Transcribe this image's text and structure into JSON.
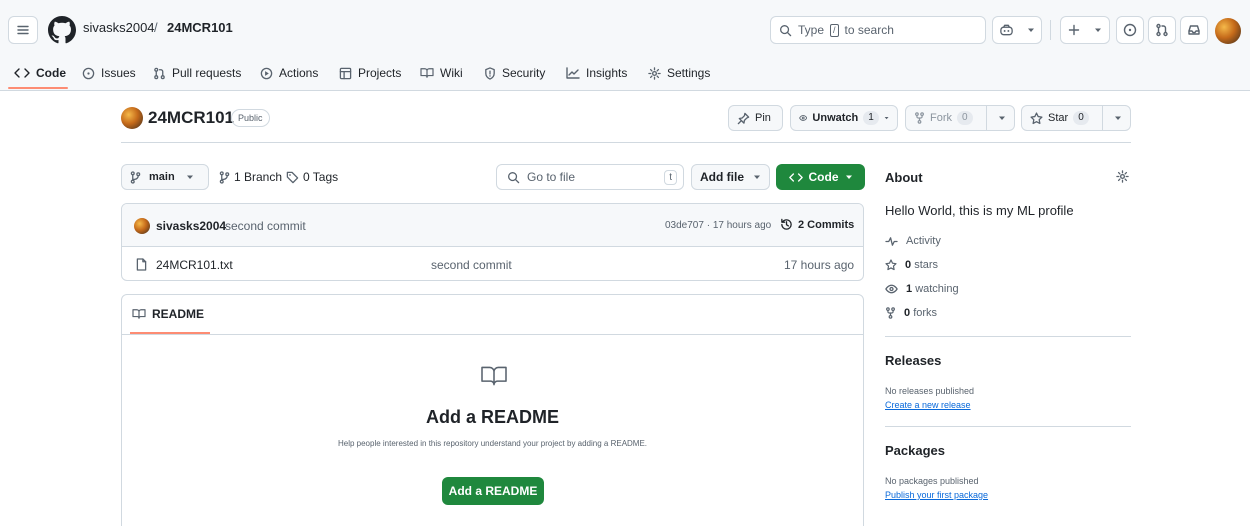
{
  "header": {
    "owner": "sivasks2004",
    "separator": "/",
    "repo": "24MCR101",
    "search_prefix": "Type",
    "search_key": "/",
    "search_suffix": "to search"
  },
  "tabs": [
    {
      "label": "Code",
      "icon": "code-icon"
    },
    {
      "label": "Issues",
      "icon": "issue-icon"
    },
    {
      "label": "Pull requests",
      "icon": "pull-request-icon"
    },
    {
      "label": "Actions",
      "icon": "play-icon"
    },
    {
      "label": "Projects",
      "icon": "table-icon"
    },
    {
      "label": "Wiki",
      "icon": "book-icon"
    },
    {
      "label": "Security",
      "icon": "shield-icon"
    },
    {
      "label": "Insights",
      "icon": "graph-icon"
    },
    {
      "label": "Settings",
      "icon": "gear-icon"
    }
  ],
  "repo_head": {
    "title": "24MCR101",
    "visibility": "Public",
    "pin_label": "Pin",
    "watch_label": "Unwatch",
    "watch_count": "1",
    "fork_label": "Fork",
    "fork_count": "0",
    "star_label": "Star",
    "star_count": "0"
  },
  "toolbar": {
    "branch": "main",
    "branches": "1 Branch",
    "tags": "0 Tags",
    "goto_placeholder": "Go to file",
    "goto_key": "t",
    "add_file": "Add file",
    "code": "Code"
  },
  "commit": {
    "author": "sivasks2004",
    "message": "second commit",
    "meta": "03de707 · 17 hours ago",
    "commits": "2 Commits"
  },
  "files": [
    {
      "name": "24MCR101.txt",
      "message": "second commit",
      "age": "17 hours ago"
    }
  ],
  "readme": {
    "tab": "README",
    "heading": "Add a README",
    "description": "Help people interested in this repository understand your project by adding a README.",
    "button": "Add a README"
  },
  "about": {
    "title": "About",
    "description": "Hello World, this is my ML profile",
    "activity": "Activity",
    "stars_count": "0",
    "stars_label": "stars",
    "watching_count": "1",
    "watching_label": "watching",
    "forks_count": "0",
    "forks_label": "forks"
  },
  "releases": {
    "title": "Releases",
    "none": "No releases published",
    "link": "Create a new release"
  },
  "packages": {
    "title": "Packages",
    "none": "No packages published",
    "link": "Publish your first package"
  },
  "colors": {
    "accent_green": "#1f883d",
    "underline": "#fd8c73",
    "link": "#0969da"
  }
}
